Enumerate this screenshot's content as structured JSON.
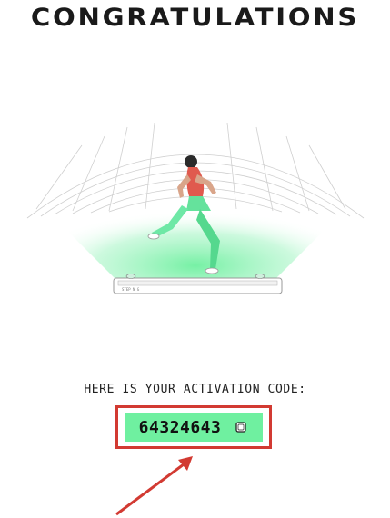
{
  "header": {
    "title": "CONGRATULATIONS"
  },
  "hero": {
    "icon": "runner-on-treadmill-illustration",
    "treadmill_small_text": [
      "STEP N G"
    ]
  },
  "activation": {
    "label": "HERE IS YOUR ACTIVATION CODE:",
    "code": "64324643",
    "copy_icon": "copy-icon"
  },
  "colors": {
    "accent_green": "#6ff0a0",
    "highlight_red": "#d23a32",
    "text_dark": "#1a1a1a"
  }
}
